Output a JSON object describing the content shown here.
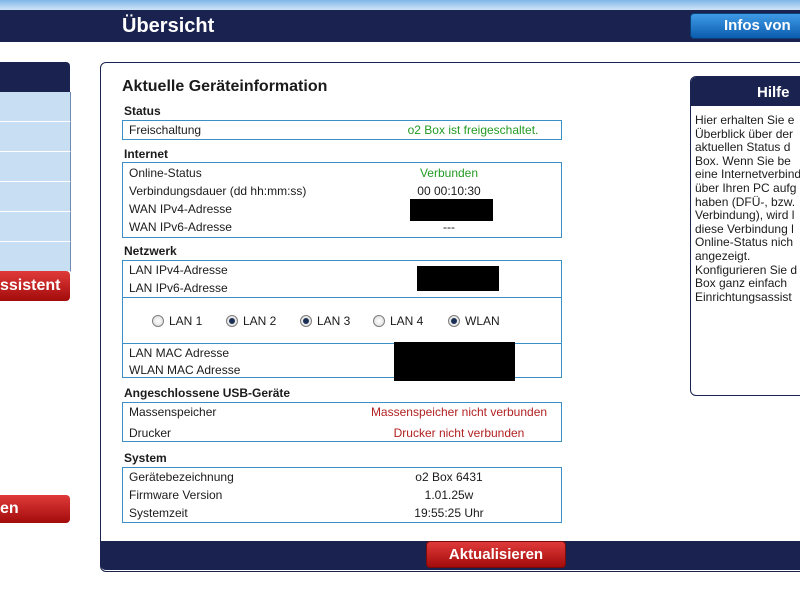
{
  "header": {
    "title": "Übersicht",
    "infos_button": "Infos von"
  },
  "sidebar": {
    "assist_button": "ssistent",
    "bottom_button": "en"
  },
  "main": {
    "title": "Aktuelle Geräteinformation",
    "status": {
      "label": "Status",
      "rows": [
        {
          "name": "Freischaltung",
          "value": "o2 Box ist freigeschaltet."
        }
      ]
    },
    "internet": {
      "label": "Internet",
      "rows": [
        {
          "name": "Online-Status",
          "value": "Verbunden"
        },
        {
          "name": "Verbindungsdauer (dd hh:mm:ss)",
          "value": "00 00:10:30"
        },
        {
          "name": "WAN IPv4-Adresse",
          "value": ""
        },
        {
          "name": "WAN IPv6-Adresse",
          "value": "---"
        }
      ]
    },
    "netzwerk": {
      "label": "Netzwerk",
      "rows_top": [
        {
          "name": "LAN IPv4-Adresse",
          "value": ""
        },
        {
          "name": "LAN IPv6-Adresse",
          "value": ""
        }
      ],
      "ports": [
        {
          "label": "LAN 1",
          "selected": false
        },
        {
          "label": "LAN 2",
          "selected": true
        },
        {
          "label": "LAN 3",
          "selected": true
        },
        {
          "label": "LAN 4",
          "selected": false
        },
        {
          "label": "WLAN",
          "selected": true
        }
      ],
      "rows_bottom": [
        {
          "name": "LAN MAC Adresse",
          "value": ""
        },
        {
          "name": "WLAN MAC Adresse",
          "value": ""
        }
      ]
    },
    "usb": {
      "label": "Angeschlossene USB-Geräte",
      "rows": [
        {
          "name": "Massenspeicher",
          "value": "Massenspeicher nicht verbunden"
        },
        {
          "name": "Drucker",
          "value": "Drucker nicht verbunden"
        }
      ]
    },
    "system": {
      "label": "System",
      "rows": [
        {
          "name": "Gerätebezeichnung",
          "value": "o2 Box 6431"
        },
        {
          "name": "Firmware Version",
          "value": "1.01.25w"
        },
        {
          "name": "Systemzeit",
          "value": "19:55:25 Uhr"
        }
      ]
    },
    "update_button": "Aktualisieren"
  },
  "help": {
    "title": "Hilfe",
    "text": "Hier erhalten Sie e\nÜberblick über der\naktuellen Status d\nBox. Wenn Sie be\neine Internetverbind\nüber Ihren PC aufg\nhaben (DFÜ-, bzw.\nVerbindung), wird l\ndiese Verbindung l\nOnline-Status nich\nangezeigt.\nKonfigurieren Sie d\nBox ganz einfach \nEinrichtungsassist"
  },
  "colors": {
    "navy": "#1a2350",
    "accent_blue": "#3a8fc7",
    "status_green": "#239b23",
    "status_red": "#b22222",
    "button_red": "#c51a1a"
  }
}
